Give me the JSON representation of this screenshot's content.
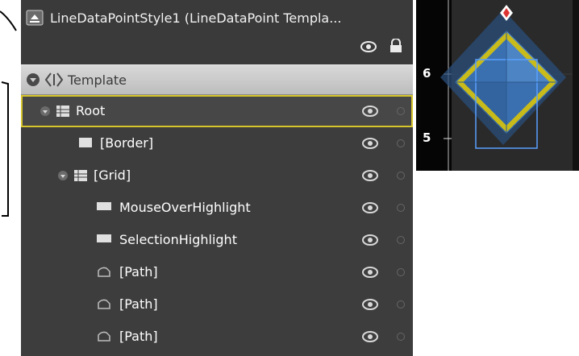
{
  "panel": {
    "title": "LineDataPointStyle1 (LineDataPoint Templa...",
    "template_label": "Template",
    "rows": [
      {
        "label": "Root"
      },
      {
        "label": "[Border]"
      },
      {
        "label": "[Grid]"
      },
      {
        "label": "MouseOverHighlight"
      },
      {
        "label": "SelectionHighlight"
      },
      {
        "label": "[Path]"
      },
      {
        "label": "[Path]"
      },
      {
        "label": "[Path]"
      }
    ]
  },
  "preview": {
    "tick_top": "6",
    "tick_bottom": "5"
  },
  "colors": {
    "panel_bg": "#3d3d3d",
    "selection_outline": "#d6c52a",
    "point_fill": "#3a6fb0",
    "highlight_yellow": "#c8bb1a"
  }
}
